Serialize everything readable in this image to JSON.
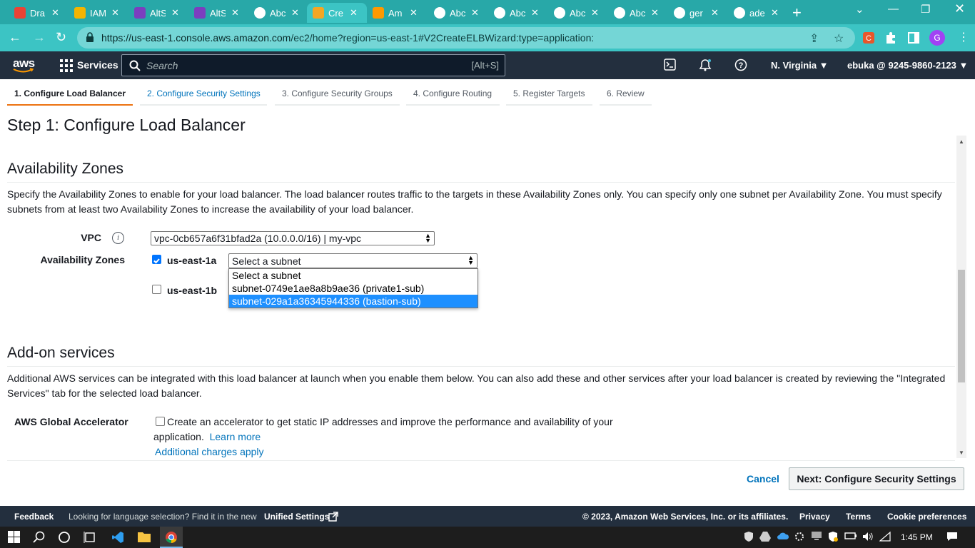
{
  "browser": {
    "tabs": [
      {
        "title": "Dra",
        "color": "#ea4335"
      },
      {
        "title": "IAM",
        "color": "#f4b400"
      },
      {
        "title": "AltS",
        "color": "#7b3fbf"
      },
      {
        "title": "AltS",
        "color": "#7b3fbf"
      },
      {
        "title": "Abc",
        "color": "#ffffff"
      },
      {
        "title": "Cre",
        "color": "#f5a623"
      },
      {
        "title": "Am",
        "color": "#ff9900"
      },
      {
        "title": "Abc",
        "color": "#ffffff"
      },
      {
        "title": "Abc",
        "color": "#ffffff"
      },
      {
        "title": "Abc",
        "color": "#ffffff"
      },
      {
        "title": "Abc",
        "color": "#ffffff"
      },
      {
        "title": "ger",
        "color": "#ffffff"
      },
      {
        "title": "ade",
        "color": "#ffffff"
      }
    ],
    "url_host": "https://us-east-1.console.aws.amazon.com",
    "url_path": "/ec2/home?region=us-east-1#V2CreateELBWizard:type=application:",
    "profile_initial": "G"
  },
  "aws": {
    "logo": "aws",
    "services_label": "Services",
    "search_placeholder": "Search",
    "search_shortcut": "[Alt+S]",
    "region": "N. Virginia ▼",
    "account": "ebuka @ 9245-9860-2123 ▼"
  },
  "wizard": {
    "steps": [
      "1. Configure Load Balancer",
      "2. Configure Security Settings",
      "3. Configure Security Groups",
      "4. Configure Routing",
      "5. Register Targets",
      "6. Review"
    ],
    "title": "Step 1: Configure Load Balancer"
  },
  "az": {
    "title": "Availability Zones",
    "description": "Specify the Availability Zones to enable for your load balancer. The load balancer routes traffic to the targets in these Availability Zones only. You can specify only one subnet per Availability Zone. You must specify subnets from at least two Availability Zones to increase the availability of your load balancer.",
    "vpc_label": "VPC",
    "vpc_value": "vpc-0cb657a6f31bfad2a (10.0.0.0/16) | my-vpc",
    "zones_label": "Availability Zones",
    "zone_a": "us-east-1a",
    "zone_b": "us-east-1b",
    "subnet_placeholder": "Select a subnet",
    "subnet_options": [
      "Select a subnet",
      "subnet-0749e1ae8a8b9ae36 (private1-sub)",
      "subnet-029a1a36345944336 (bastion-sub)"
    ]
  },
  "addon": {
    "title": "Add-on services",
    "description": "Additional AWS services can be integrated with this load balancer at launch when you enable them below. You can also add these and other services after your load balancer is created by reviewing the \"Integrated Services\" tab for the selected load balancer.",
    "accelerator_label": "AWS Global Accelerator",
    "accelerator_text_1": "Create an accelerator to get static IP addresses and improve the performance and availability of your",
    "accelerator_text_2": "application.",
    "learn_more": "Learn more",
    "charges": "Additional charges apply"
  },
  "actions": {
    "cancel": "Cancel",
    "next": "Next: Configure Security Settings"
  },
  "footer": {
    "feedback": "Feedback",
    "lang_text": "Looking for language selection? Find it in the new",
    "unified": "Unified Settings",
    "copyright": "© 2023, Amazon Web Services, Inc. or its affiliates.",
    "privacy": "Privacy",
    "terms": "Terms",
    "cookies": "Cookie preferences"
  },
  "taskbar": {
    "time": "1:45 PM"
  }
}
